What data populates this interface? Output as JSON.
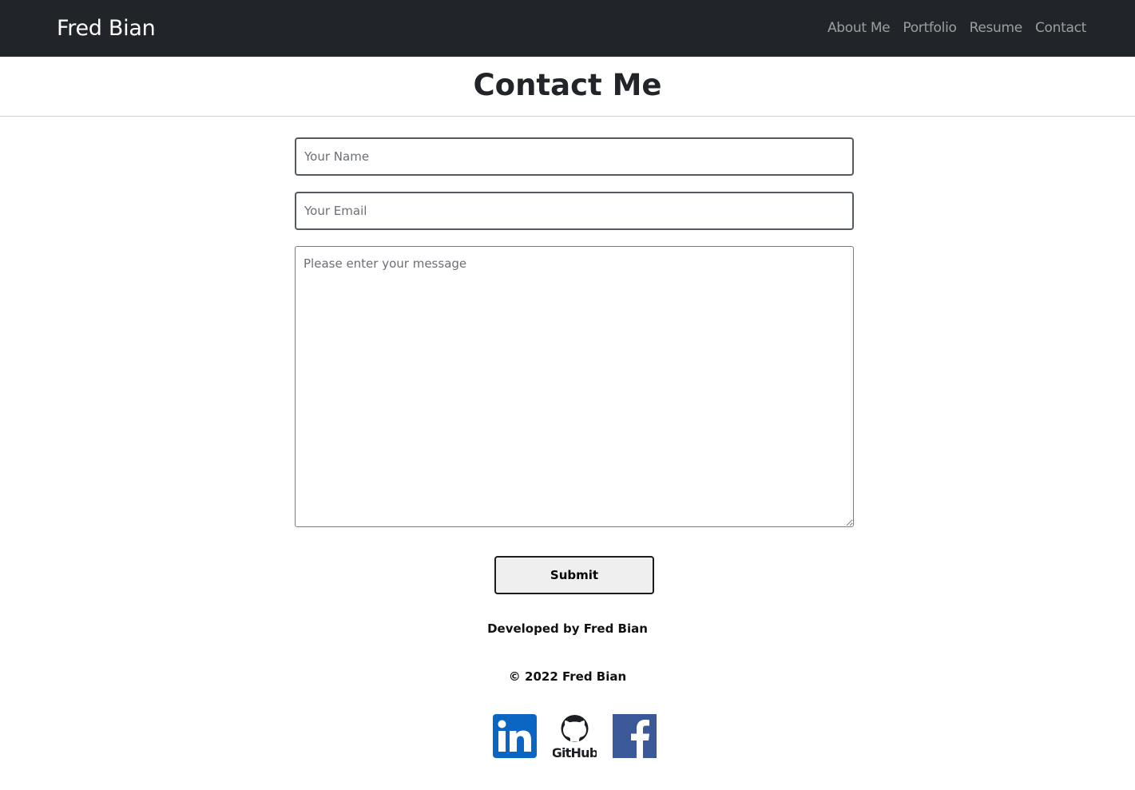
{
  "navbar": {
    "brand": "Fred Bian",
    "links": [
      {
        "label": "About Me"
      },
      {
        "label": "Portfolio"
      },
      {
        "label": "Resume"
      },
      {
        "label": "Contact"
      }
    ]
  },
  "main": {
    "title": "Contact Me",
    "form": {
      "name_placeholder": "Your Name",
      "name_value": "",
      "email_placeholder": "Your Email",
      "email_value": "",
      "message_placeholder": "Please enter your message",
      "message_value": "",
      "submit_label": "Submit"
    }
  },
  "footer": {
    "developed_by": "Developed by Fred Bian",
    "copyright": "© 2022 Fred Bian",
    "socials": [
      {
        "icon": "linkedin-icon",
        "color": "#0a66c2"
      },
      {
        "icon": "github-icon",
        "label": "GitHub",
        "color": "#1b1f23"
      },
      {
        "icon": "facebook-icon",
        "color": "#3b5998"
      }
    ]
  },
  "colors": {
    "navbar_bg": "#212529",
    "brand": "#ffffff",
    "nav_link": "rgba(255,255,255,0.55)"
  }
}
